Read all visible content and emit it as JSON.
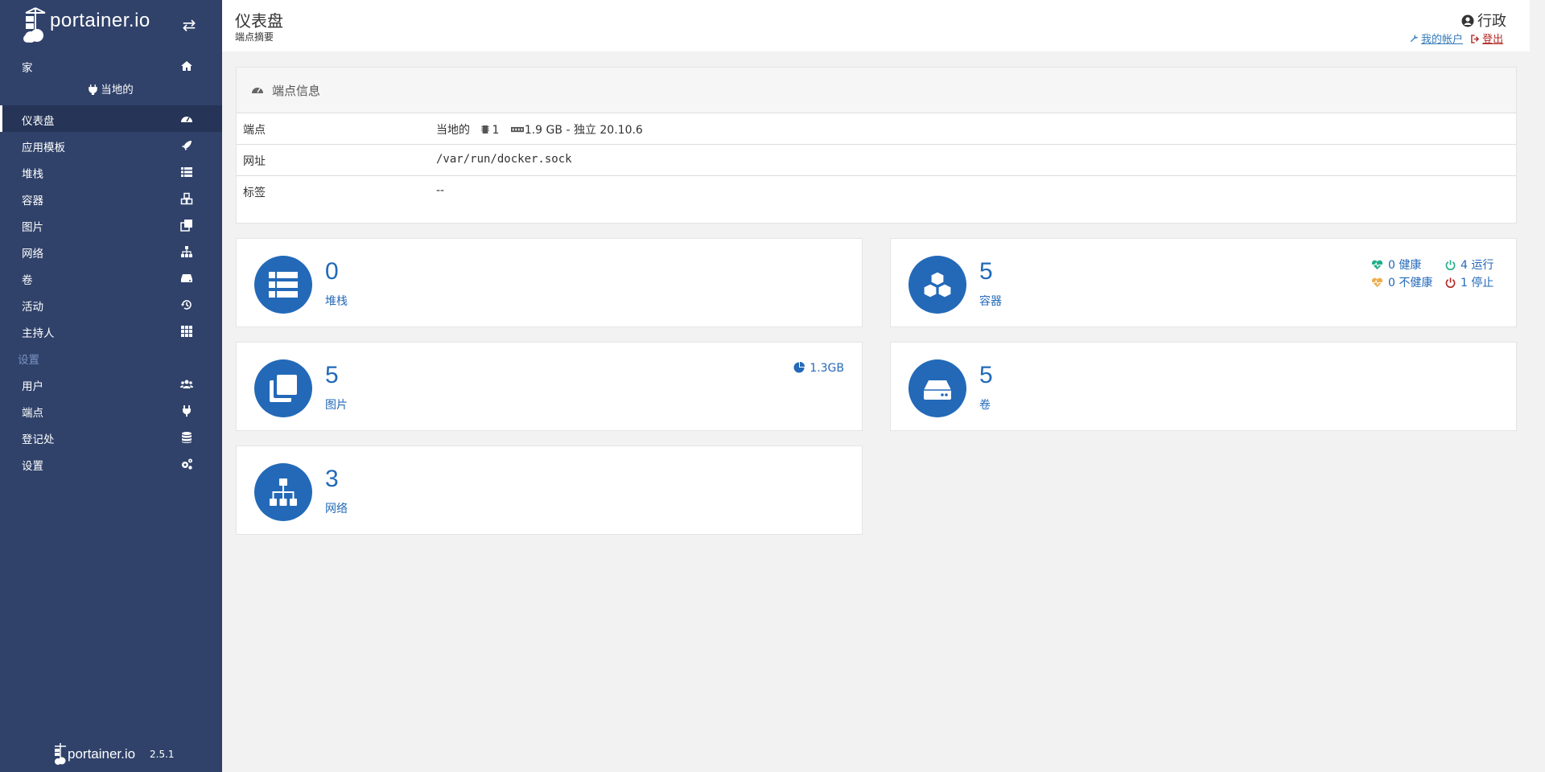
{
  "brand": {
    "name": "portainer.io",
    "version": "2.5.1"
  },
  "sidebar": {
    "home": "家",
    "endpoint": "当地的",
    "items": [
      {
        "label": "仪表盘",
        "icon": "tachometer-icon",
        "active": true
      },
      {
        "label": "应用模板",
        "icon": "rocket-icon"
      },
      {
        "label": "堆栈",
        "icon": "th-list-icon"
      },
      {
        "label": "容器",
        "icon": "cubes-icon"
      },
      {
        "label": "图片",
        "icon": "clone-icon"
      },
      {
        "label": "网络",
        "icon": "sitemap-icon"
      },
      {
        "label": "卷",
        "icon": "hdd-icon"
      },
      {
        "label": "活动",
        "icon": "history-icon"
      },
      {
        "label": "主持人",
        "icon": "th-icon"
      }
    ],
    "settings_heading": "设置",
    "settings_items": [
      {
        "label": "用户",
        "icon": "users-icon"
      },
      {
        "label": "端点",
        "icon": "plug-icon"
      },
      {
        "label": "登记处",
        "icon": "database-icon"
      },
      {
        "label": "设置",
        "icon": "cogs-icon"
      }
    ]
  },
  "header": {
    "title": "仪表盘",
    "subtitle": "端点摘要",
    "user": "行政",
    "my_account": "我的帐户",
    "logout": "登出"
  },
  "endpoint_info": {
    "title": "端点信息",
    "rows": [
      {
        "key": "端点",
        "name": "当地的",
        "cpu": "1",
        "memory": "1.9 GB",
        "type": "- 独立 20.10.6"
      },
      {
        "key": "网址",
        "value": "/var/run/docker.sock"
      },
      {
        "key": "标签",
        "value": "--"
      }
    ]
  },
  "stats": {
    "stacks": {
      "count": "0",
      "label": "堆栈"
    },
    "containers": {
      "count": "5",
      "label": "容器",
      "healthy": "0 健康",
      "running": "4 运行",
      "unhealthy": "0 不健康",
      "stopped": "1 停止"
    },
    "images": {
      "count": "5",
      "label": "图片",
      "size": "1.3GB"
    },
    "volumes": {
      "count": "5",
      "label": "卷"
    },
    "networks": {
      "count": "3",
      "label": "网络"
    }
  },
  "colors": {
    "sidebar_bg": "#30426a",
    "accent": "#2369b8",
    "healthy": "#23ae89",
    "unhealthy": "#f0ad4e",
    "stopped": "#b32824"
  }
}
